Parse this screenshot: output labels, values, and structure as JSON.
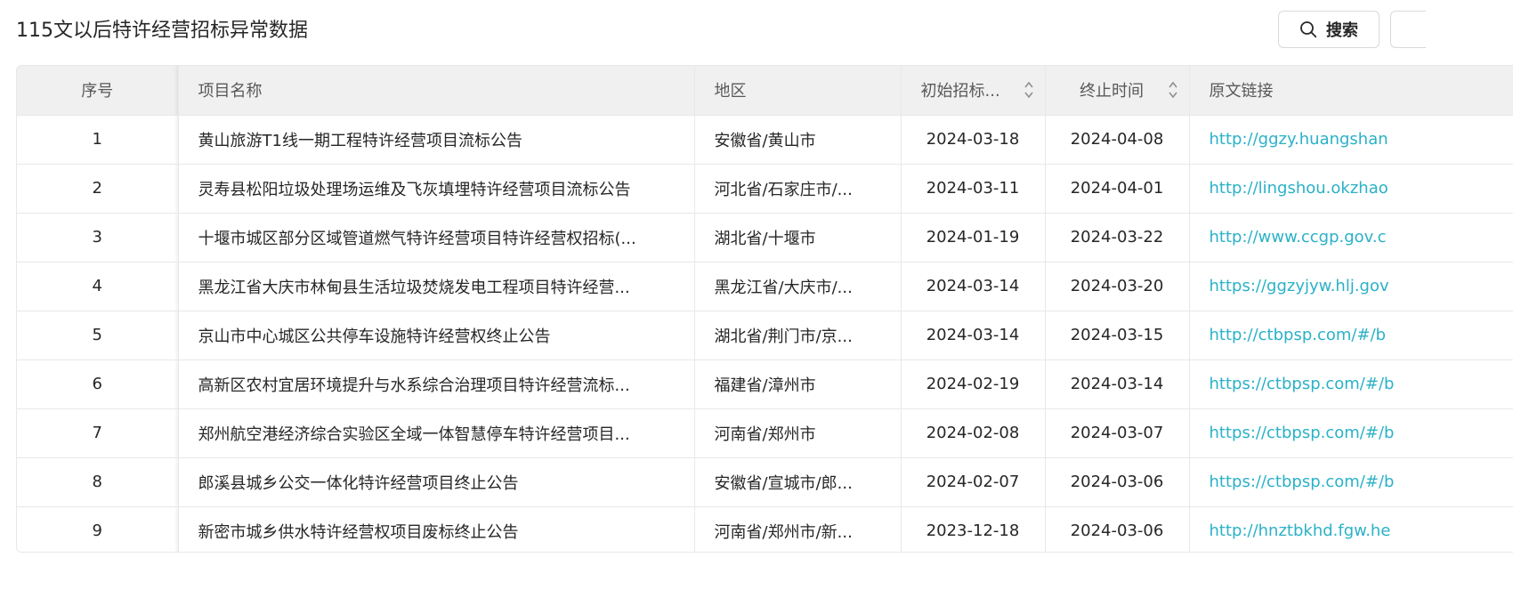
{
  "page": {
    "title": "115文以后特许经营招标异常数据",
    "search_label": "搜索",
    "search_icon": "search-icon"
  },
  "table": {
    "columns": [
      "序号",
      "项目名称",
      "地区",
      "初始招标...",
      "终止时间",
      "原文链接"
    ],
    "rows": [
      {
        "idx": "1",
        "name": "黄山旅游T1线一期工程特许经营项目流标公告",
        "region": "安徽省/黄山市",
        "start": "2024-03-18",
        "end": "2024-04-08",
        "link": "http://ggzy.huangshan"
      },
      {
        "idx": "2",
        "name": "灵寿县松阳垃圾处理场运维及飞灰填埋特许经营项目流标公告",
        "region": "河北省/石家庄市/...",
        "start": "2024-03-11",
        "end": "2024-04-01",
        "link": "http://lingshou.okzhao"
      },
      {
        "idx": "3",
        "name": "十堰市城区部分区域管道燃气特许经营项目特许经营权招标(...",
        "region": "湖北省/十堰市",
        "start": "2024-01-19",
        "end": "2024-03-22",
        "link": "http://www.ccgp.gov.c"
      },
      {
        "idx": "4",
        "name": "黑龙江省大庆市林甸县生活垃圾焚烧发电工程项目特许经营...",
        "region": "黑龙江省/大庆市/...",
        "start": "2024-03-14",
        "end": "2024-03-20",
        "link": "https://ggzyjyw.hlj.gov"
      },
      {
        "idx": "5",
        "name": "京山市中心城区公共停车设施特许经营权终止公告",
        "region": "湖北省/荆门市/京...",
        "start": "2024-03-14",
        "end": "2024-03-15",
        "link": "http://ctbpsp.com/#/b"
      },
      {
        "idx": "6",
        "name": "高新区农村宜居环境提升与水系综合治理项目特许经营流标...",
        "region": "福建省/漳州市",
        "start": "2024-02-19",
        "end": "2024-03-14",
        "link": "https://ctbpsp.com/#/b"
      },
      {
        "idx": "7",
        "name": "郑州航空港经济综合实验区全域一体智慧停车特许经营项目...",
        "region": "河南省/郑州市",
        "start": "2024-02-08",
        "end": "2024-03-07",
        "link": "https://ctbpsp.com/#/b"
      },
      {
        "idx": "8",
        "name": "郎溪县城乡公交一体化特许经营项目终止公告",
        "region": "安徽省/宣城市/郎...",
        "start": "2024-02-07",
        "end": "2024-03-06",
        "link": "https://ctbpsp.com/#/b"
      },
      {
        "idx": "9",
        "name": "新密市城乡供水特许经营权项目废标终止公告",
        "region": "河南省/郑州市/新...",
        "start": "2023-12-18",
        "end": "2024-03-06",
        "link": "http://hnztbkhd.fgw.he"
      }
    ]
  },
  "colors": {
    "link": "#2bb1c7",
    "header_bg": "#f0f0f0",
    "border": "#e8e8e8"
  }
}
